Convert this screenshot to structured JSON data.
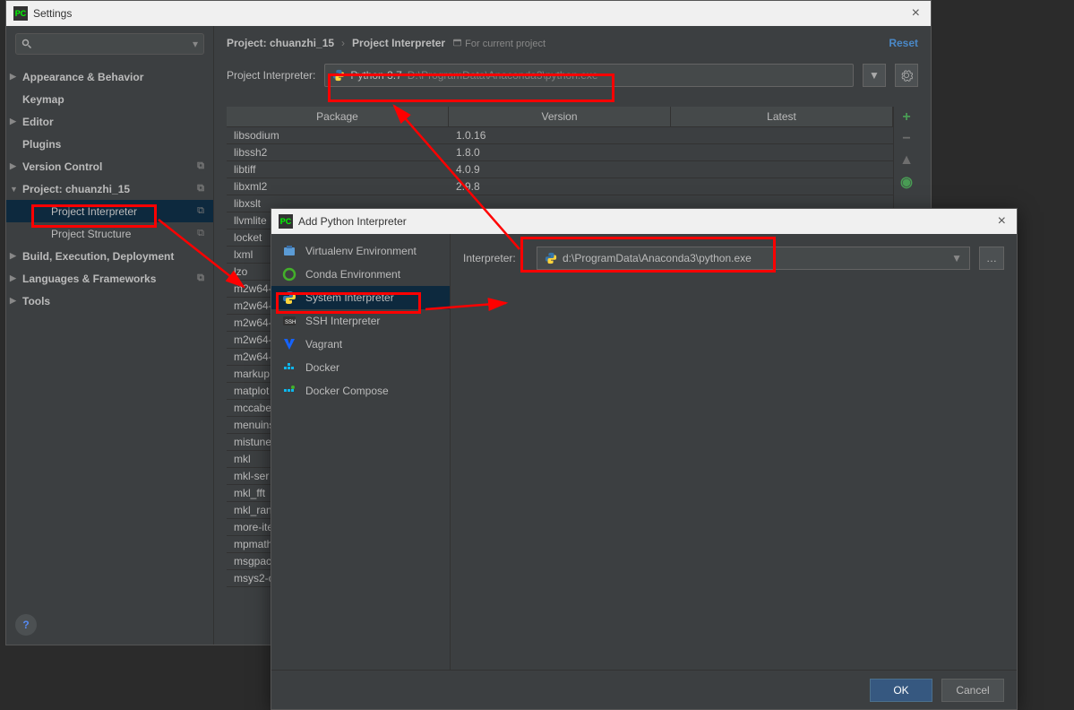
{
  "window": {
    "title": "Settings"
  },
  "sidebar": {
    "search_placeholder": "",
    "items": [
      {
        "label": "Appearance & Behavior",
        "bold": true,
        "arrow": "▶"
      },
      {
        "label": "Keymap",
        "bold": true,
        "arrow": ""
      },
      {
        "label": "Editor",
        "bold": true,
        "arrow": "▶"
      },
      {
        "label": "Plugins",
        "bold": true,
        "arrow": ""
      },
      {
        "label": "Version Control",
        "bold": true,
        "arrow": "▶",
        "copy": true
      },
      {
        "label": "Project: chuanzhi_15",
        "bold": true,
        "arrow": "▼",
        "copy": true
      },
      {
        "label": "Project Interpreter",
        "bold": false,
        "child": true,
        "selected": true,
        "copy": true
      },
      {
        "label": "Project Structure",
        "bold": false,
        "child": true,
        "copy": true
      },
      {
        "label": "Build, Execution, Deployment",
        "bold": true,
        "arrow": "▶"
      },
      {
        "label": "Languages & Frameworks",
        "bold": true,
        "arrow": "▶",
        "copy": true
      },
      {
        "label": "Tools",
        "bold": true,
        "arrow": "▶"
      }
    ]
  },
  "breadcrumb": {
    "project": "Project: chuanzhi_15",
    "page": "Project Interpreter",
    "hint": "For current project",
    "reset": "Reset"
  },
  "interpreter": {
    "label": "Project Interpreter:",
    "name": "Python 3.7",
    "path": "D:\\ProgramData\\Anaconda3\\python.exe"
  },
  "table": {
    "headers": [
      "Package",
      "Version",
      "Latest"
    ],
    "rows": [
      {
        "pkg": "libsodium",
        "ver": "1.0.16",
        "lat": ""
      },
      {
        "pkg": "libssh2",
        "ver": "1.8.0",
        "lat": ""
      },
      {
        "pkg": "libtiff",
        "ver": "4.0.9",
        "lat": ""
      },
      {
        "pkg": "libxml2",
        "ver": "2.9.8",
        "lat": ""
      },
      {
        "pkg": "libxslt",
        "ver": "",
        "lat": ""
      },
      {
        "pkg": "llvmlite",
        "ver": "",
        "lat": ""
      },
      {
        "pkg": "locket",
        "ver": "",
        "lat": ""
      },
      {
        "pkg": "lxml",
        "ver": "",
        "lat": ""
      },
      {
        "pkg": "lzo",
        "ver": "",
        "lat": ""
      },
      {
        "pkg": "m2w64-",
        "ver": "",
        "lat": ""
      },
      {
        "pkg": "m2w64-",
        "ver": "",
        "lat": ""
      },
      {
        "pkg": "m2w64-",
        "ver": "",
        "lat": ""
      },
      {
        "pkg": "m2w64-",
        "ver": "",
        "lat": ""
      },
      {
        "pkg": "m2w64-",
        "ver": "",
        "lat": ""
      },
      {
        "pkg": "markup",
        "ver": "",
        "lat": ""
      },
      {
        "pkg": "matplot",
        "ver": "",
        "lat": ""
      },
      {
        "pkg": "mccabe",
        "ver": "",
        "lat": ""
      },
      {
        "pkg": "menuins",
        "ver": "",
        "lat": ""
      },
      {
        "pkg": "mistune",
        "ver": "",
        "lat": ""
      },
      {
        "pkg": "mkl",
        "ver": "",
        "lat": ""
      },
      {
        "pkg": "mkl-ser",
        "ver": "",
        "lat": ""
      },
      {
        "pkg": "mkl_fft",
        "ver": "",
        "lat": ""
      },
      {
        "pkg": "mkl_ran",
        "ver": "",
        "lat": ""
      },
      {
        "pkg": "more-ite",
        "ver": "",
        "lat": ""
      },
      {
        "pkg": "mpmath",
        "ver": "",
        "lat": ""
      },
      {
        "pkg": "msgpac",
        "ver": "",
        "lat": ""
      },
      {
        "pkg": "msys2-c",
        "ver": "",
        "lat": ""
      }
    ]
  },
  "dialog": {
    "title": "Add Python Interpreter",
    "envs": [
      {
        "label": "Virtualenv Environment",
        "icon": "venv"
      },
      {
        "label": "Conda Environment",
        "icon": "conda"
      },
      {
        "label": "System Interpreter",
        "icon": "python",
        "selected": true
      },
      {
        "label": "SSH Interpreter",
        "icon": "ssh"
      },
      {
        "label": "Vagrant",
        "icon": "vagrant"
      },
      {
        "label": "Docker",
        "icon": "docker"
      },
      {
        "label": "Docker Compose",
        "icon": "compose"
      }
    ],
    "interp_label": "Interpreter:",
    "interp_path": "d:\\ProgramData\\Anaconda3\\python.exe",
    "ok": "OK",
    "cancel": "Cancel"
  }
}
